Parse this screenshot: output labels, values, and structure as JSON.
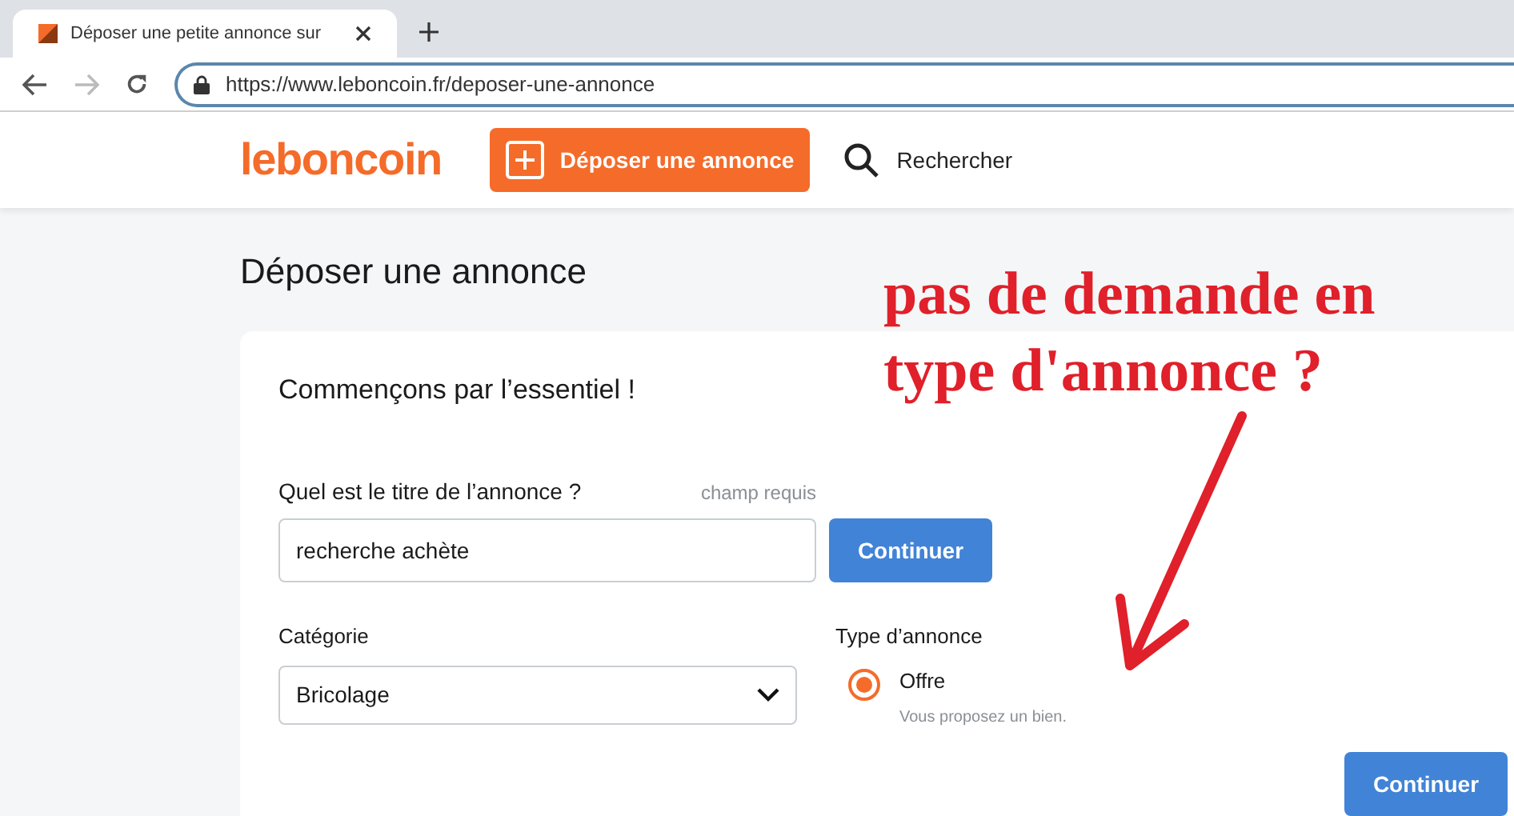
{
  "browser": {
    "tab_title": "Déposer une petite annonce sur",
    "url": "https://www.leboncoin.fr/deposer-une-annonce"
  },
  "header": {
    "logo": "leboncoin",
    "post_button": "Déposer une annonce",
    "search": "Rechercher"
  },
  "page_title": "Déposer une annonce",
  "form": {
    "heading": "Commençons par l’essentiel !",
    "title_field": {
      "label": "Quel est le titre de l’annonce ?",
      "hint": "champ requis",
      "value": "recherche achète",
      "button": "Continuer"
    },
    "category": {
      "label": "Catégorie",
      "value": "Bricolage"
    },
    "ad_type": {
      "label": "Type d’annonce",
      "options": [
        {
          "label": "Offre",
          "description": "Vous proposez un bien.",
          "selected": true
        }
      ]
    },
    "button": "Continuer"
  },
  "annotation": {
    "lines": [
      "pas de demande en",
      "type d'annonce ?"
    ]
  }
}
